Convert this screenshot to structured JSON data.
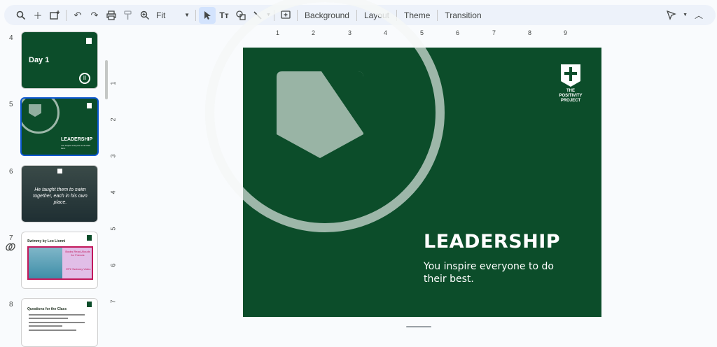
{
  "toolbar": {
    "zoom_value": "Fit",
    "background_label": "Background",
    "layout_label": "Layout",
    "theme_label": "Theme",
    "transition_label": "Transition"
  },
  "filmstrip": {
    "slides": [
      {
        "number": "4",
        "title": "Day 1"
      },
      {
        "number": "5",
        "title": "LEADERSHIP",
        "subtitle": "You inspire everyone to do their best."
      },
      {
        "number": "6",
        "quote": "He taught them to swim together, each in his own place."
      },
      {
        "number": "7",
        "title": "Swimmy by Leo Lionni",
        "book_label": "Books Read-Alouds for Friends",
        "book_sub": "EP2 Swimmy Video"
      },
      {
        "number": "8",
        "title": "Questions for the Class"
      }
    ]
  },
  "ruler": {
    "horizontal": [
      "1",
      "2",
      "3",
      "4",
      "5",
      "6",
      "7",
      "8",
      "9"
    ],
    "vertical": [
      "1",
      "2",
      "3",
      "4",
      "5",
      "6",
      "7"
    ]
  },
  "slide": {
    "title": "LEADERSHIP",
    "subtitle": "You inspire everyone to do their best.",
    "logo_text": "THE POSITIVITY PROJECT",
    "background_color": "#0c4d2a"
  }
}
